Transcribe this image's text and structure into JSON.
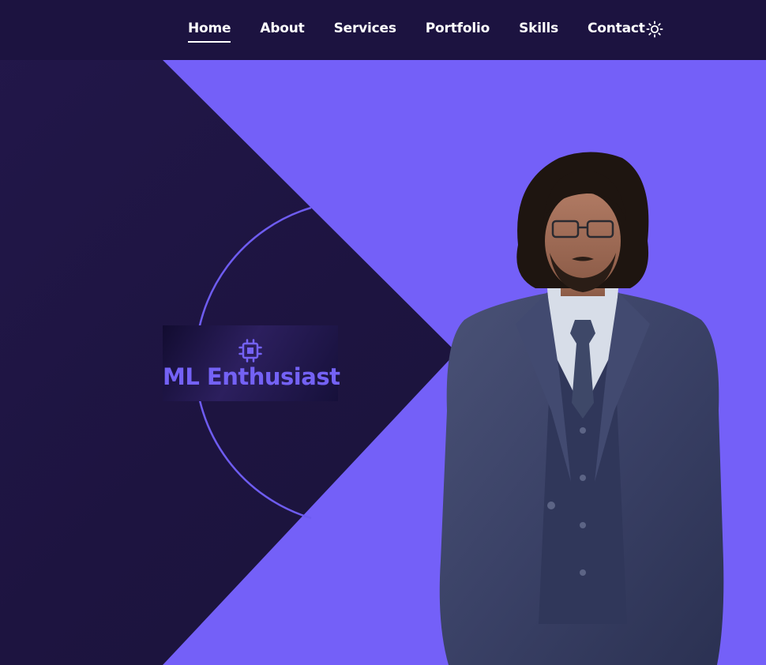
{
  "nav": {
    "items": [
      {
        "label": "Home",
        "active": true
      },
      {
        "label": "About",
        "active": false
      },
      {
        "label": "Services",
        "active": false
      },
      {
        "label": "Portfolio",
        "active": false
      },
      {
        "label": "Skills",
        "active": false
      },
      {
        "label": "Contact",
        "active": false
      }
    ],
    "theme_toggle_icon": "sun-icon"
  },
  "hero": {
    "role_icon": "cpu-chip-icon",
    "role_title": "ML Enthusiast",
    "portrait_icon": "person-portrait"
  },
  "colors": {
    "background": "#1d1440",
    "navbar": "#1c1340",
    "accent": "#7462f5",
    "text": "#ffffff"
  }
}
